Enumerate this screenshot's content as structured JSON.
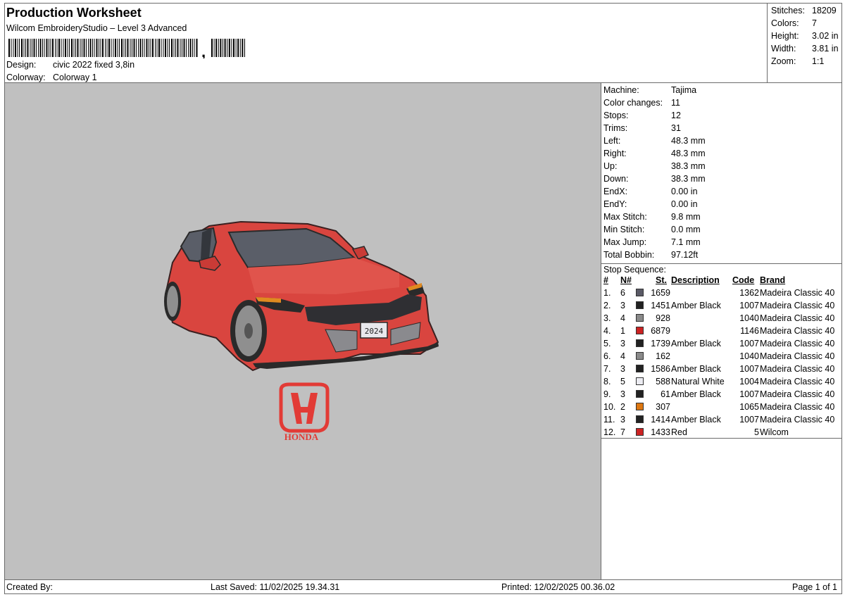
{
  "header": {
    "title": "Production Worksheet",
    "subtitle": "Wilcom EmbroideryStudio – Level 3 Advanced",
    "barcode_suffix": ",",
    "design_label": "Design:",
    "design_value": "civic 2022 fixed 3,8in",
    "colorway_label": "Colorway:",
    "colorway_value": "Colorway 1"
  },
  "stats": [
    {
      "label": "Stitches:",
      "value": "18209"
    },
    {
      "label": "Colors:",
      "value": "7"
    },
    {
      "label": "Height:",
      "value": "3.02 in"
    },
    {
      "label": "Width:",
      "value": "3.81 in"
    },
    {
      "label": "Zoom:",
      "value": "1:1"
    }
  ],
  "machine": [
    {
      "label": "Machine:",
      "value": "Tajima"
    },
    {
      "label": "Color changes:",
      "value": "11"
    },
    {
      "label": "Stops:",
      "value": "12"
    },
    {
      "label": "Trims:",
      "value": "31"
    },
    {
      "label": "Left:",
      "value": "48.3 mm"
    },
    {
      "label": "Right:",
      "value": "48.3 mm"
    },
    {
      "label": "Up:",
      "value": "38.3 mm"
    },
    {
      "label": "Down:",
      "value": "38.3 mm"
    },
    {
      "label": "EndX:",
      "value": "0.00 in"
    },
    {
      "label": "EndY:",
      "value": "0.00 in"
    },
    {
      "label": "Max Stitch:",
      "value": "9.8 mm"
    },
    {
      "label": "Min Stitch:",
      "value": "0.0 mm"
    },
    {
      "label": "Max Jump:",
      "value": "7.1 mm"
    },
    {
      "label": "Total Bobbin:",
      "value": "97.12ft"
    }
  ],
  "sequence": {
    "title": "Stop Sequence:",
    "headers": {
      "num": "#",
      "n": "N#",
      "st": "St.",
      "desc": "Description",
      "code": "Code",
      "brand": "Brand"
    },
    "rows": [
      {
        "num": "1.",
        "n": "6",
        "color": "#5a5a66",
        "st": "1659",
        "desc": "",
        "code": "1362",
        "brand": "Madeira Classic 40"
      },
      {
        "num": "2.",
        "n": "3",
        "color": "#222222",
        "st": "1451",
        "desc": "Amber Black",
        "code": "1007",
        "brand": "Madeira Classic 40"
      },
      {
        "num": "3.",
        "n": "4",
        "color": "#8a8a8a",
        "st": "928",
        "desc": "",
        "code": "1040",
        "brand": "Madeira Classic 40"
      },
      {
        "num": "4.",
        "n": "1",
        "color": "#cc2222",
        "st": "6879",
        "desc": "",
        "code": "1146",
        "brand": "Madeira Classic 40"
      },
      {
        "num": "5.",
        "n": "3",
        "color": "#222222",
        "st": "1739",
        "desc": "Amber Black",
        "code": "1007",
        "brand": "Madeira Classic 40"
      },
      {
        "num": "6.",
        "n": "4",
        "color": "#8a8a8a",
        "st": "162",
        "desc": "",
        "code": "1040",
        "brand": "Madeira Classic 40"
      },
      {
        "num": "7.",
        "n": "3",
        "color": "#222222",
        "st": "1586",
        "desc": "Amber Black",
        "code": "1007",
        "brand": "Madeira Classic 40"
      },
      {
        "num": "8.",
        "n": "5",
        "color": "#ececf2",
        "st": "588",
        "desc": "Natural White",
        "code": "1004",
        "brand": "Madeira Classic 40"
      },
      {
        "num": "9.",
        "n": "3",
        "color": "#222222",
        "st": "61",
        "desc": "Amber Black",
        "code": "1007",
        "brand": "Madeira Classic 40"
      },
      {
        "num": "10.",
        "n": "2",
        "color": "#dd7711",
        "st": "307",
        "desc": "",
        "code": "1065",
        "brand": "Madeira Classic 40"
      },
      {
        "num": "11.",
        "n": "3",
        "color": "#222222",
        "st": "1414",
        "desc": "Amber Black",
        "code": "1007",
        "brand": "Madeira Classic 40"
      },
      {
        "num": "12.",
        "n": "7",
        "color": "#cc2222",
        "st": "1433",
        "desc": "Red",
        "code": "5",
        "brand": "Wilcom"
      }
    ]
  },
  "logo_text": "HONDA",
  "plate_text": "2024",
  "footer": {
    "created": "Created By:",
    "saved": "Last Saved: 11/02/2025 19.34.31",
    "printed": "Printed: 12/02/2025 00.36.02",
    "page": "Page 1 of 1"
  }
}
